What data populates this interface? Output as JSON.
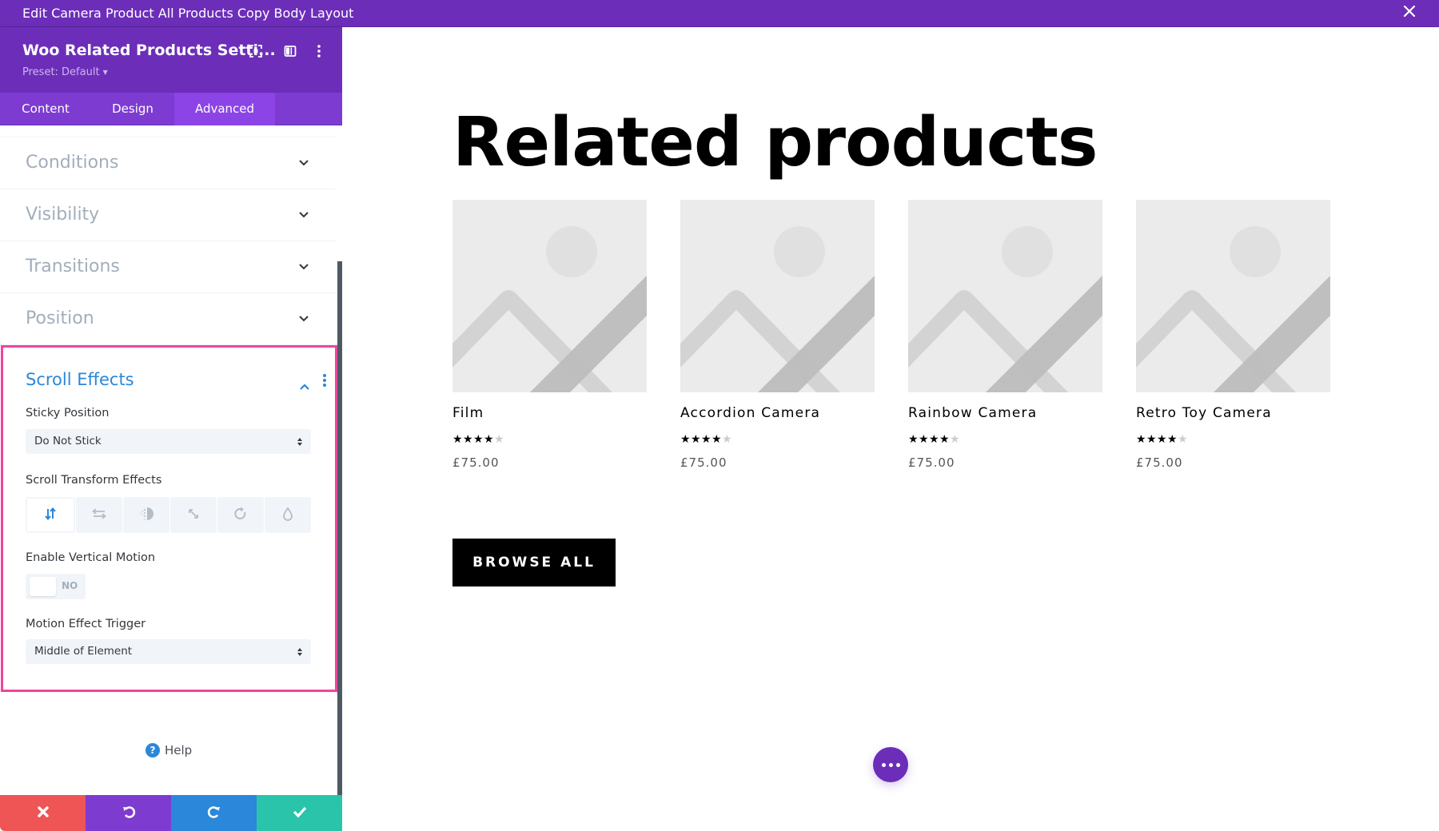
{
  "window": {
    "title": "Edit Camera Product All Products Copy Body Layout",
    "close_icon": "close-icon"
  },
  "panel": {
    "module_title": "Woo Related Products Setti...",
    "preset_label": "Preset: Default",
    "header_icons": [
      "focus-mode-icon",
      "sidebar-layout-icon",
      "more-vertical-icon"
    ],
    "tabs": [
      {
        "label": "Content",
        "active": false
      },
      {
        "label": "Design",
        "active": false
      },
      {
        "label": "Advanced",
        "active": true
      }
    ],
    "sections": [
      {
        "label": "Conditions",
        "expanded": false
      },
      {
        "label": "Visibility",
        "expanded": false
      },
      {
        "label": "Transitions",
        "expanded": false
      },
      {
        "label": "Position",
        "expanded": false
      }
    ],
    "scroll_effects": {
      "title": "Scroll Effects",
      "expanded": true,
      "highlight_color": "#f0449d",
      "sticky_position": {
        "label": "Sticky Position",
        "value": "Do Not Stick"
      },
      "transform_effects": {
        "label": "Scroll Transform Effects",
        "options": [
          {
            "icon": "vertical-motion-icon",
            "active": true
          },
          {
            "icon": "horizontal-motion-icon",
            "active": false
          },
          {
            "icon": "fading-icon",
            "active": false
          },
          {
            "icon": "scaling-icon",
            "active": false
          },
          {
            "icon": "rotating-icon",
            "active": false
          },
          {
            "icon": "blur-icon",
            "active": false
          }
        ]
      },
      "vertical_motion": {
        "label": "Enable Vertical Motion",
        "value": "NO"
      },
      "motion_trigger": {
        "label": "Motion Effect Trigger",
        "value": "Middle of Element"
      }
    },
    "help_label": "Help",
    "footer": {
      "buttons": [
        {
          "name": "cancel",
          "icon": "close-icon",
          "color": "#ef5555"
        },
        {
          "name": "undo",
          "icon": "undo-icon",
          "color": "#7e3bd0"
        },
        {
          "name": "redo",
          "icon": "redo-icon",
          "color": "#2b87da"
        },
        {
          "name": "save",
          "icon": "check-icon",
          "color": "#29c4a9"
        }
      ]
    }
  },
  "main": {
    "heading": "Related products",
    "products": [
      {
        "name": "Film",
        "rating": 4,
        "rating_max": 5,
        "price": "£75.00"
      },
      {
        "name": "Accordion Camera",
        "rating": 4,
        "rating_max": 5,
        "price": "£75.00"
      },
      {
        "name": "Rainbow Camera",
        "rating": 4,
        "rating_max": 5,
        "price": "£75.00"
      },
      {
        "name": "Retro Toy Camera",
        "rating": 4,
        "rating_max": 5,
        "price": "£75.00"
      }
    ],
    "browse_button": "BROWSE ALL"
  },
  "colors": {
    "brand_purple": "#6c2eb9",
    "tab_bar": "#7d3bd1",
    "tab_active": "#8c44e6",
    "accent_blue": "#2b87da"
  }
}
